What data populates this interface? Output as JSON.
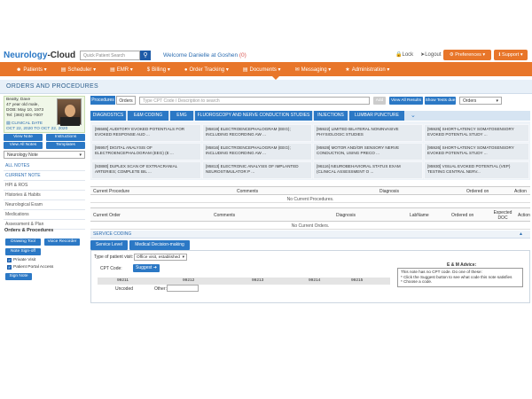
{
  "header": {
    "brand_a": "Neurology",
    "brand_b": "-Cloud",
    "quick_search_placeholder": "Quick Patient Search",
    "welcome_text": "Welcome Danielle at Goshen",
    "welcome_count": "(0)",
    "lock_label": "Lock",
    "logout_label": "Logout",
    "preferences_label": "Preferences",
    "support_label": "Support"
  },
  "nav": {
    "items": [
      "Patients",
      "Scheduler",
      "EMR",
      "Billing",
      "Order Tracking",
      "Documents",
      "Messaging",
      "Administration"
    ]
  },
  "page": {
    "title": "ORDERS AND PROCEDURES"
  },
  "patient": {
    "name": "Beatty, Dave",
    "age": "47 year old male,",
    "dob": "DOB: May 10, 1973",
    "tel": "Tel: (360) 801-7007",
    "clinical_label": "CLINICAL DATE",
    "clinical_dates": "OCT 22, 2020 TO OCT 22, 2020"
  },
  "sidebar": {
    "view_note": "View Note",
    "instructions": "Instructions",
    "view_all_notes": "View All Notes",
    "templates": "Templates",
    "note_type": "Neurology Note",
    "items": [
      "ALL NOTES",
      "CURRENT NOTE",
      "HPI & ROS",
      "Histories & Habits",
      "Neurological Exam",
      "Medications",
      "Assessment & Plan"
    ],
    "orders_head": "Orders & Procedures",
    "drawing_tool": "Drawing Tool",
    "voice_recorder": "Voice Recorder",
    "note_signoff": "Note Sign-off",
    "private_visit": "Private Visit",
    "patient_portal": "Patient Portal Access",
    "sign_note": "Sign Note"
  },
  "toolbar": {
    "tab_procedures": "Procedures",
    "tab_orders": "Orders",
    "cpt_placeholder": "Type CPT Code / Description to search",
    "add": "Add",
    "view_all_results": "View All Results",
    "show_tests_due": "Show Tests due",
    "orders_select": "Orders"
  },
  "categories": [
    "DIAGNOSTICS",
    "E&M CODING",
    "EMG",
    "FLUOROSCOPY AND NERVE CONDUCTION STUDIES",
    "INJECTIONS",
    "LUMBAR PUNCTURE"
  ],
  "procedures": [
    [
      "[95585] AUDITORY EVOKED POTENTIALS FOR EVOKED RESPONSE AUD ...",
      "[95819] ELECTROENCEPHALOGRAM (EEG); INCLUDING RECORDING AW ...",
      "[95922] LIMITED BILATERAL NONINVASIVE PHYSIOLOGIC STUDIES",
      "[95925] SHORT-LATENCY SOMATOSENSORY EVOKED POTENTIAL STUDY ..."
    ],
    [
      "[95957] DIGITAL ANALYSIS OF ELECTROENCEPHALOGRAM (EEG) (E ...",
      "[95816] ELECTROENCEPHALOGRAM (EEG); INCLUDING RECORDING AW ...",
      "[95928] MOTOR AND/OR SENSORY NERVE CONDUCTION, USING PRECO ...",
      "[95926] SHORT-LATENCY SOMATOSENSORY EVOKED POTENTIAL STUDY ..."
    ],
    [
      "[93880] DUPLEX SCAN OF EXTRACRANIAL ARTERIES; COMPLETE BIL ...",
      "[95813] ELECTRONIC ANALYSIS OF IMPLANTED NEUROSTIMULATOR P ...",
      "[96116] NEUROBEHAVIORAL STATUS EXAM (CLINICAL ASSESSMENT O ...",
      "[95930] VISUAL EVOKED POTENTIAL (VEP) TESTING CENTRAL NERV..."
    ]
  ],
  "current_procedure": {
    "headers": [
      "Current Procedure",
      "Comments",
      "Diagnosis",
      "Ordered on",
      "Action"
    ],
    "empty": "No Current Procedures."
  },
  "current_order": {
    "headers": [
      "Current Order",
      "Comments",
      "Diagnosis",
      "LabName",
      "Ordered on",
      "Expected DOC",
      "Action"
    ],
    "empty": "No Current Orders."
  },
  "service": {
    "head": "SERVICE CODING",
    "tab_level": "Service Level",
    "tab_mdm": "Medical Decision-making",
    "visit_type_label": "Type of patient visit:",
    "visit_type_value": "Office visit, established",
    "cpt_label": "CPT Code:",
    "suggest": "Suggest",
    "codes": [
      "99211",
      "99212",
      "99213",
      "99214",
      "99215"
    ],
    "uncoded": "Uncoded",
    "other": "Other:",
    "em_title": "E & M Advice:",
    "em_lines": [
      "This note has no CPT code. Do one of these:",
      "* Click the Suggest button to see what code this note satisfies",
      "* Choose a code."
    ]
  }
}
